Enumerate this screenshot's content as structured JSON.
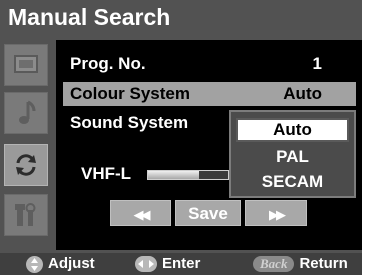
{
  "menu": {
    "title": "Manual Search",
    "rows": [
      {
        "label": "Prog. No.",
        "value": "1"
      },
      {
        "label": "Colour System",
        "value": "Auto"
      },
      {
        "label": "Sound System",
        "value": ""
      }
    ],
    "dropdown": {
      "options": [
        "Auto",
        "PAL",
        "SECAM"
      ],
      "selected": "Auto"
    },
    "band": {
      "label": "VHF-L",
      "level_percent": 64
    },
    "buttons": {
      "rewind": "◀◀",
      "save": "Save",
      "forward": "▶▶"
    }
  },
  "sidebar": {
    "tabs": [
      {
        "icon": "screen-icon",
        "active": false
      },
      {
        "icon": "music-note-icon",
        "active": false
      },
      {
        "icon": "refresh-icon",
        "active": true
      },
      {
        "icon": "tools-icon",
        "active": false
      }
    ]
  },
  "footer": {
    "adjust": "Adjust",
    "enter": "Enter",
    "back_badge": "Back",
    "return": "Return"
  },
  "colors": {
    "background": "#525252",
    "panel": "#000000",
    "selected_row": "#a2a2a2",
    "button": "#a8a8a8"
  }
}
